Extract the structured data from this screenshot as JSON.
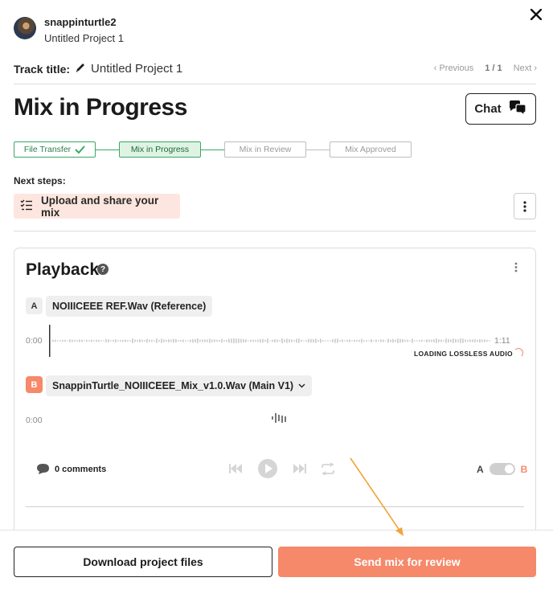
{
  "header": {
    "username": "snappinturtle2",
    "project_name": "Untitled Project 1",
    "close_label": "✕"
  },
  "track": {
    "label": "Track title:",
    "value": "Untitled Project 1",
    "pager_previous": "Previous",
    "pager_count": "1 / 1",
    "pager_next": "Next"
  },
  "status_title": "Mix in Progress",
  "chat_label": "Chat",
  "steps": [
    {
      "label": "File Transfer",
      "state": "done"
    },
    {
      "label": "Mix in Progress",
      "state": "active"
    },
    {
      "label": "Mix in Review",
      "state": "pending"
    },
    {
      "label": "Mix Approved",
      "state": "pending"
    }
  ],
  "next_steps": {
    "label": "Next steps:",
    "task": "Upload and share your mix"
  },
  "playback": {
    "title": "Playback",
    "help": "?",
    "track_a": {
      "badge": "A",
      "name": "NOIIICEEE REF.Wav (Reference)",
      "time_start": "0:00",
      "time_end": "1:11",
      "loading_text": "LOADING LOSSLESS AUDIO"
    },
    "track_b": {
      "badge": "B",
      "name": "SnappinTurtle_NOIIICEEE_Mix_v1.0.Wav (Main V1)",
      "time_start": "0:00"
    },
    "comments": "0 comments",
    "ab_a": "A",
    "ab_b": "B"
  },
  "footer": {
    "download_label": "Download project files",
    "send_label": "Send mix for review"
  },
  "colors": {
    "accent": "#f5896a",
    "success": "#3aa864",
    "success_bg": "#dff3e4",
    "next_step_bg": "#fde6df"
  }
}
